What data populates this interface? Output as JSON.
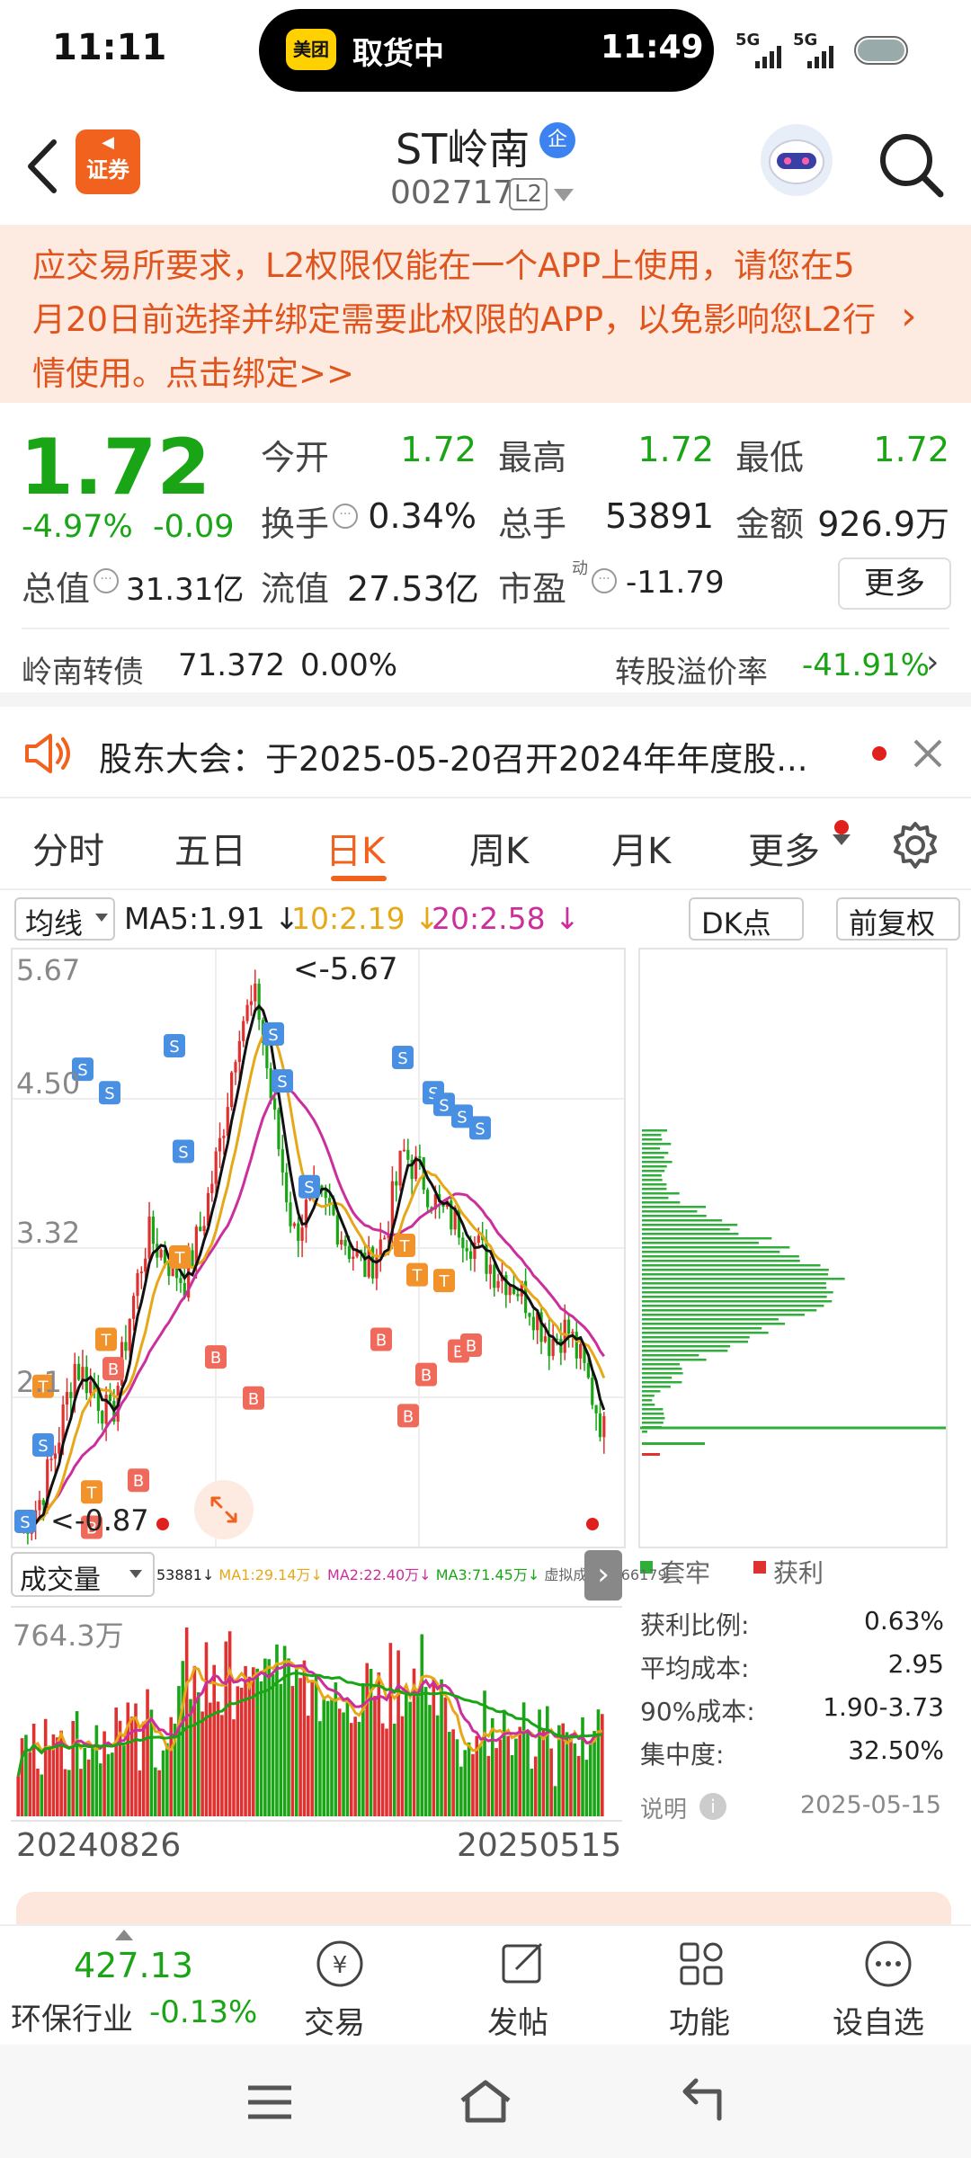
{
  "status_bar": {
    "time": "11:11",
    "live_app_logo": "美团",
    "live_status": "取货中",
    "live_time": "11:49",
    "network_1": "5G",
    "network_2": "5G"
  },
  "header": {
    "stock_name": "ST岭南",
    "verified_badge": "企",
    "stock_code": "002717",
    "level_badge": "L2",
    "app_logo_text": "证券"
  },
  "banner": {
    "text": "应交易所要求，L2权限仅能在一个APP上使用，请您在5月20日前选择并绑定需要此权限的APP，以免影响您L2行情使用。点击绑定>>"
  },
  "quote": {
    "price": "1.72",
    "change_pct": "-4.97%",
    "change": "-0.09",
    "open_label": "今开",
    "open": "1.72",
    "high_label": "最高",
    "high": "1.72",
    "low_label": "最低",
    "low": "1.72",
    "turnover_label": "换手",
    "turnover": "0.34%",
    "volume_label": "总手",
    "volume": "53891",
    "amount_label": "金额",
    "amount": "926.9万",
    "mktcap_label": "总值",
    "mktcap": "31.31亿",
    "float_label": "流值",
    "float_cap": "27.53亿",
    "pe_label": "市盈",
    "pe_sup": "动",
    "pe": "-11.79",
    "more": "更多"
  },
  "bond": {
    "name": "岭南转债",
    "price": "71.372",
    "change": "0.00%",
    "premium_label": "转股溢价率",
    "premium": "-41.91%"
  },
  "notice": {
    "text": "股东大会：于2025-05-20召开2024年年度股..."
  },
  "tabs": [
    "分时",
    "五日",
    "日K",
    "周K",
    "月K",
    "更多"
  ],
  "active_tab": "日K",
  "kline": {
    "indicator": "均线",
    "ma5": "MA5:1.91 ↓",
    "ma10": "10:2.19 ↓",
    "ma20": "20:2.58 ↓",
    "dk": "DK点",
    "fq": "前复权",
    "y_labels": [
      "5.67",
      "4.50",
      "3.32",
      "2.1"
    ],
    "max_marker": "<-5.67",
    "min_marker": "<-0.87",
    "ma_colors": {
      "ma5": "#111111",
      "ma10": "#e6a817",
      "ma20": "#cc2e9c"
    }
  },
  "volume": {
    "label": "成交量",
    "stats": [
      "53881↓",
      "MA1:29.14万↓",
      "MA2:22.40万↓",
      "MA3:71.45万↓",
      "虚拟成交量:66179"
    ],
    "max_label": "764.3万",
    "date_start": "20240826",
    "date_end": "20250515"
  },
  "chips": {
    "legend_trapped": "套牢",
    "legend_profit": "获利",
    "rows": [
      {
        "label": "获利比例:",
        "value": "0.63%"
      },
      {
        "label": "平均成本:",
        "value": "2.95"
      },
      {
        "label": "90%成本:",
        "value": "1.90-3.73"
      },
      {
        "label": "集中度:",
        "value": "32.50%"
      }
    ],
    "note": "说明",
    "date": "2025-05-15"
  },
  "bottom_bar": {
    "index_value": "427.13",
    "index_name": "环保行业",
    "index_change": "-0.13%",
    "buttons": [
      "交易",
      "发帖",
      "功能",
      "设自选"
    ]
  },
  "colors": {
    "up": "#e03131",
    "down": "#19a515",
    "accent": "#f2621f"
  }
}
